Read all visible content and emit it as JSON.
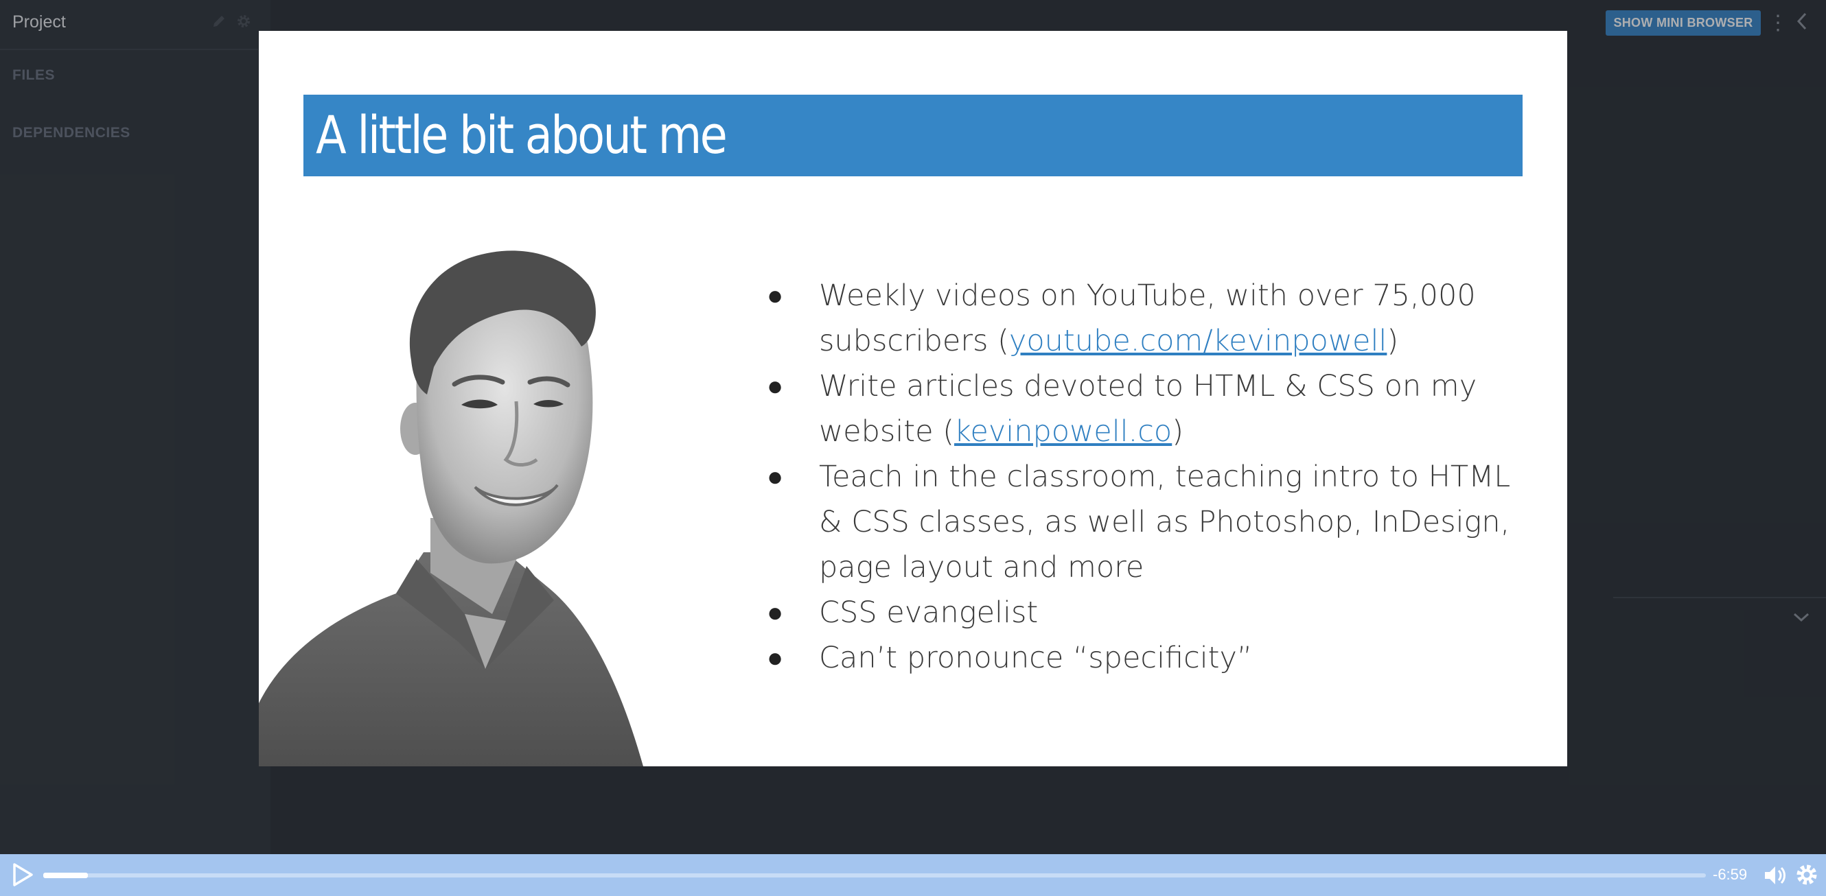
{
  "sidebar": {
    "title": "Project",
    "sections": [
      "FILES",
      "DEPENDENCIES"
    ],
    "icons": [
      "pencil-icon",
      "gear-icon"
    ]
  },
  "right_panel": {
    "mini_browser_label": "SHOW MINI BROWSER",
    "icons": [
      "kebab-menu-icon",
      "chevron-left-icon",
      "chevron-down-icon"
    ]
  },
  "slide": {
    "title": "A little bit about me",
    "bullets": [
      {
        "before": "Weekly videos on YouTube, with over 75,000 subscribers (",
        "link": "youtube.com/kevinpowell",
        "after": ")"
      },
      {
        "before": "Write articles devoted to HTML & CSS on my website (",
        "link": "kevinpowell.co",
        "after": ")"
      },
      {
        "before": "Teach in the classroom, teaching intro to HTML & CSS classes, as well as Photoshop, InDesign, page layout and more",
        "link": "",
        "after": ""
      },
      {
        "before": "CSS evangelist",
        "link": "",
        "after": ""
      },
      {
        "before": "Can’t pronounce “specificity”",
        "link": "",
        "after": ""
      }
    ],
    "banner_color": "#3686c6",
    "link_color": "#2f7fc1"
  },
  "player": {
    "time_remaining": "-6:59",
    "progress": 0.027,
    "bar_color": "#a4c5ef",
    "icons": [
      "play-icon",
      "volume-icon",
      "settings-gear-icon"
    ]
  }
}
